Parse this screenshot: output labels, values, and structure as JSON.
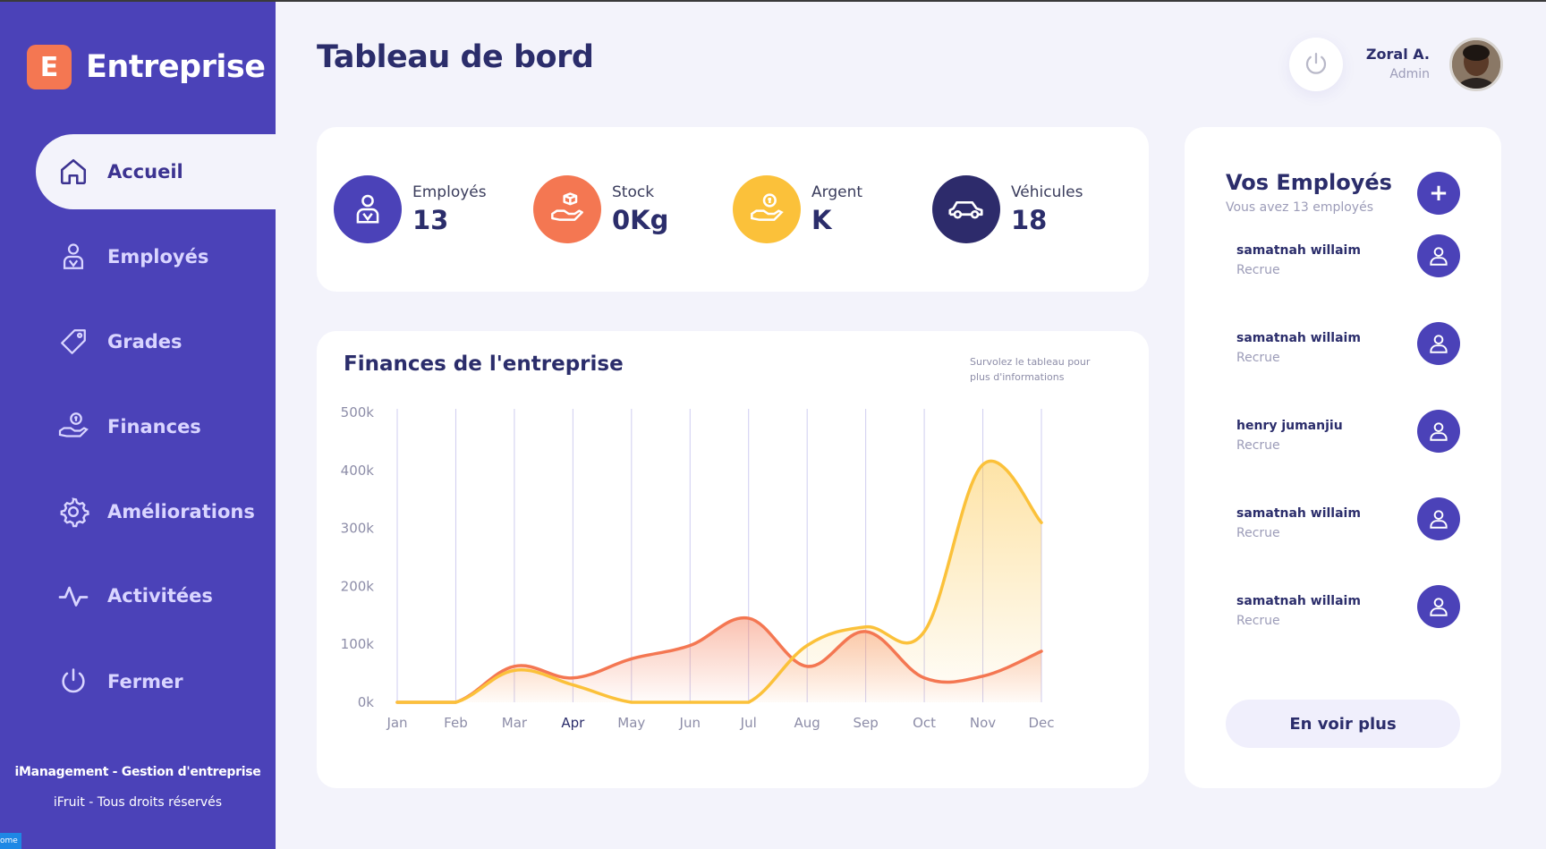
{
  "brand": {
    "badge": "E",
    "name": "Entreprise"
  },
  "sidebar": {
    "items": [
      {
        "label": "Accueil",
        "icon": "home-icon",
        "active": true
      },
      {
        "label": "Employés",
        "icon": "employee-icon"
      },
      {
        "label": "Grades",
        "icon": "tag-icon"
      },
      {
        "label": "Finances",
        "icon": "money-hand-icon"
      },
      {
        "label": "Améliorations",
        "icon": "gear-icon"
      },
      {
        "label": "Activitées",
        "icon": "activity-icon"
      },
      {
        "label": "Fermer",
        "icon": "power-icon"
      }
    ],
    "footer_line1": "iManagement - Gestion d'entreprise",
    "footer_line2": "iFruit - Tous droits réservés",
    "corner_tag": "ome"
  },
  "header": {
    "title": "Tableau de bord",
    "user_name": "Zoral A.",
    "user_role": "Admin"
  },
  "stats": [
    {
      "label": "Employés",
      "value": "13",
      "color": "#4b42b8",
      "icon": "employee-icon"
    },
    {
      "label": "Stock",
      "value": "0Kg",
      "color": "#f47752",
      "icon": "box-hand-icon"
    },
    {
      "label": "Argent",
      "value": "K",
      "color": "#fbc13a",
      "icon": "money-hand-icon"
    },
    {
      "label": "Véhicules",
      "value": "18",
      "color": "#2d2b6b",
      "icon": "car-icon"
    }
  ],
  "chart": {
    "title": "Finances de l'entreprise",
    "hint": "Survolez le tableau pour plus d'informations"
  },
  "chart_data": {
    "type": "area",
    "categories": [
      "Jan",
      "Feb",
      "Mar",
      "Apr",
      "May",
      "Jun",
      "Jul",
      "Aug",
      "Sep",
      "Oct",
      "Nov",
      "Dec"
    ],
    "series": [
      {
        "color": "#f47752",
        "values": [
          0,
          0,
          62000,
          42000,
          75000,
          98000,
          145000,
          62000,
          122000,
          42000,
          45000,
          88000
        ]
      },
      {
        "color": "#fbc13a",
        "values": [
          0,
          0,
          55000,
          30000,
          0,
          0,
          0,
          98000,
          130000,
          122000,
          410000,
          310000
        ]
      }
    ],
    "yticks": [
      "0k",
      "100k",
      "200k",
      "300k",
      "400k",
      "500k"
    ],
    "ylim": [
      0,
      500000
    ],
    "grid": "vertical"
  },
  "employees": {
    "title": "Vos Employés",
    "subtitle": "Vous avez 13 employés",
    "list": [
      {
        "name": "samatnah willaim",
        "role": "Recrue"
      },
      {
        "name": "samatnah willaim",
        "role": "Recrue"
      },
      {
        "name": "henry jumanjiu",
        "role": "Recrue"
      },
      {
        "name": "samatnah willaim",
        "role": "Recrue"
      },
      {
        "name": "samatnah willaim",
        "role": "Recrue"
      }
    ],
    "more_label": "En voir plus"
  }
}
